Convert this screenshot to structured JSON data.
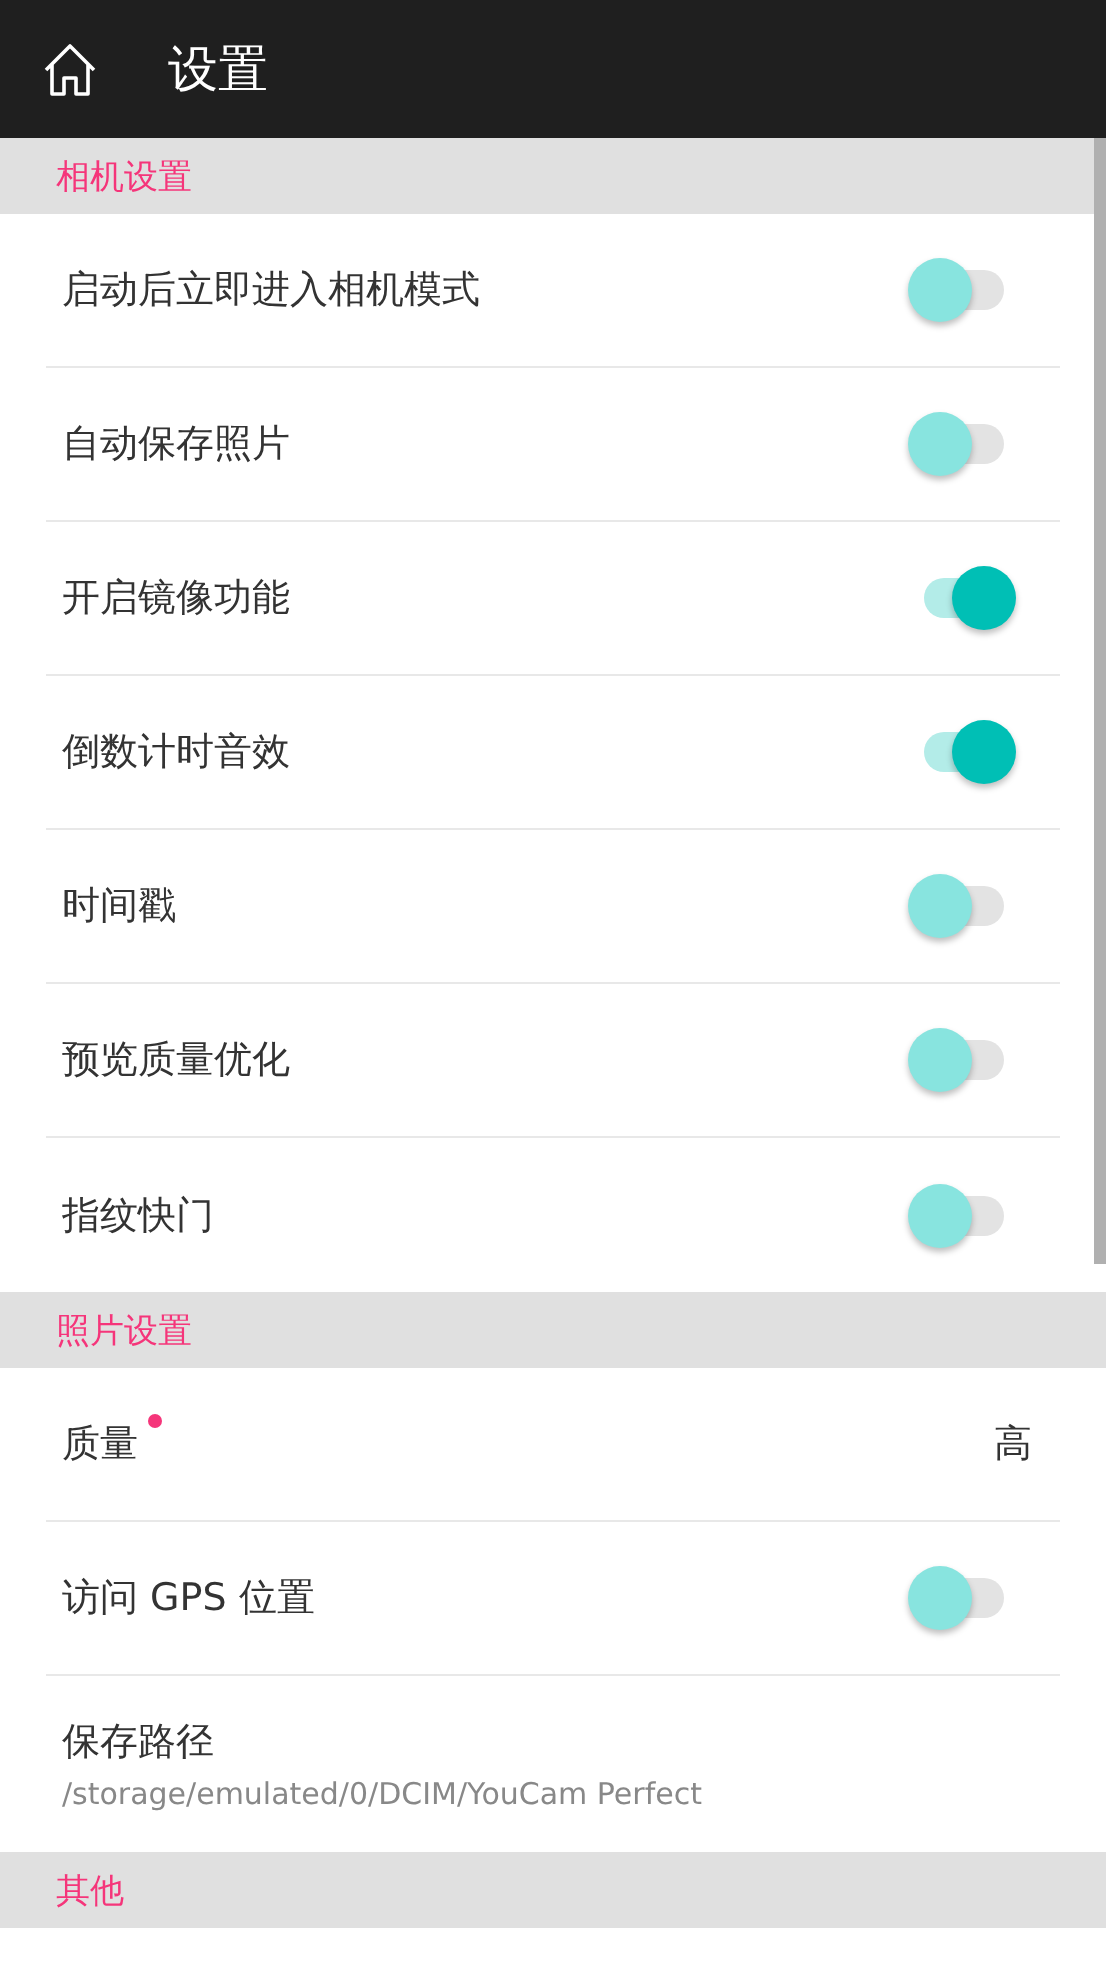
{
  "app_bar": {
    "title": "设置"
  },
  "sections": [
    {
      "title": "相机设置",
      "items": [
        {
          "kind": "toggle",
          "label": "启动后立即进入相机模式",
          "on": false
        },
        {
          "kind": "toggle",
          "label": "自动保存照片",
          "on": false
        },
        {
          "kind": "toggle",
          "label": "开启镜像功能",
          "on": true
        },
        {
          "kind": "toggle",
          "label": "倒数计时音效",
          "on": true
        },
        {
          "kind": "toggle",
          "label": "时间戳",
          "on": false
        },
        {
          "kind": "toggle",
          "label": "预览质量优化",
          "on": false
        },
        {
          "kind": "toggle",
          "label": "指纹快门",
          "on": false
        }
      ]
    },
    {
      "title": "照片设置",
      "items": [
        {
          "kind": "value",
          "label": "质量",
          "value": "高",
          "new": true
        },
        {
          "kind": "toggle",
          "label": "访问 GPS 位置",
          "on": false
        },
        {
          "kind": "path",
          "label": "保存路径",
          "summary": "/storage/emulated/0/DCIM/YouCam Perfect"
        }
      ]
    },
    {
      "title": "其他"
    }
  ]
}
